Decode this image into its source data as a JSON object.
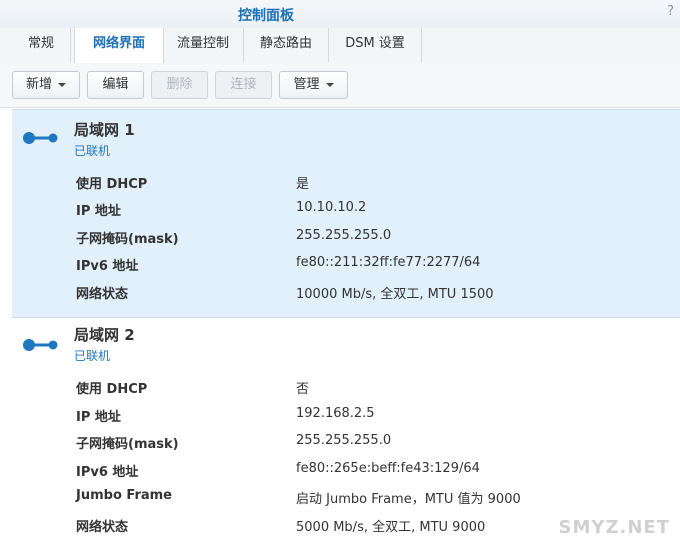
{
  "window": {
    "title": "控制面板",
    "help_glyph": "?"
  },
  "tabs": [
    {
      "label": "常规",
      "active": false
    },
    {
      "label": "网络界面",
      "active": true
    },
    {
      "label": "流量控制",
      "active": false
    },
    {
      "label": "静态路由",
      "active": false
    },
    {
      "label": "DSM 设置",
      "active": false
    }
  ],
  "toolbar": {
    "add": "新增",
    "edit": "编辑",
    "delete": "删除",
    "connect": "连接",
    "manage": "管理"
  },
  "interfaces": [
    {
      "name": "局域网 1",
      "status": "已联机",
      "selected": true,
      "rows": [
        {
          "label": "使用 DHCP",
          "value": "是"
        },
        {
          "label": "IP 地址",
          "value": "10.10.10.2"
        },
        {
          "label": "子网掩码(mask)",
          "value": "255.255.255.0"
        },
        {
          "label": "IPv6 地址",
          "value": "fe80::211:32ff:fe77:2277/64"
        },
        {
          "label": "网络状态",
          "value": "10000 Mb/s, 全双工, MTU 1500"
        }
      ]
    },
    {
      "name": "局域网 2",
      "status": "已联机",
      "selected": false,
      "rows": [
        {
          "label": "使用 DHCP",
          "value": "否"
        },
        {
          "label": "IP 地址",
          "value": "192.168.2.5"
        },
        {
          "label": "子网掩码(mask)",
          "value": "255.255.255.0"
        },
        {
          "label": "IPv6 地址",
          "value": "fe80::265e:beff:fe43:129/64"
        },
        {
          "label": "Jumbo Frame",
          "value": "启动 Jumbo Frame，MTU 值为 9000"
        },
        {
          "label": "网络状态",
          "value": "5000 Mb/s, 全双工, MTU 9000"
        }
      ]
    }
  ],
  "watermark": "SMYZ.NET",
  "colors": {
    "accent": "#1f6fb5",
    "selected_bg": "#e1f0fa",
    "icon": "#1f77c0"
  }
}
